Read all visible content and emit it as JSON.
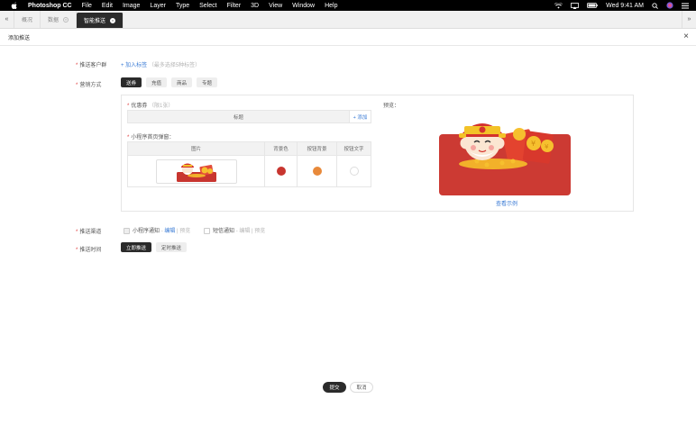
{
  "menubar": {
    "app_name": "Photoshop CC",
    "items": [
      "File",
      "Edit",
      "Image",
      "Layer",
      "Type",
      "Select",
      "Filter",
      "3D",
      "View",
      "Window",
      "Help"
    ],
    "clock": "Wed 9:41 AM"
  },
  "tabs": [
    {
      "label": "概况",
      "active": false,
      "closable": false
    },
    {
      "label": "数据",
      "active": false,
      "closable": true
    },
    {
      "label": "智能推送",
      "active": true,
      "closable": true
    }
  ],
  "header": {
    "title": "添加推送"
  },
  "form": {
    "audience": {
      "label": "推送客户群",
      "add_link": "+ 加入标签",
      "hint": "（最多选择5种标签）"
    },
    "marketing": {
      "label": "营销方式",
      "options": [
        "送券",
        "充值",
        "商品",
        "专题"
      ],
      "selected": 0
    },
    "coupon": {
      "label": "优惠券",
      "hint": "（限1张）",
      "title_col": "标题",
      "add_link": "+ 添加"
    },
    "popup": {
      "label": "小程序首页弹窗：",
      "columns": [
        "图片",
        "背景色",
        "按钮背景",
        "按钮文字"
      ],
      "colors": {
        "bg": "#c8352f",
        "button_bg": "#e8893a",
        "button_text": "#ffffff"
      }
    },
    "preview": {
      "label": "预览：",
      "example_link": "查看示例"
    },
    "channel": {
      "label": "推送渠道",
      "mini_program": {
        "label": "小程序通知",
        "edit": "编辑",
        "preview": "预览",
        "checked": true
      },
      "sms": {
        "label": "短信通知",
        "edit": "编辑",
        "preview": "预览",
        "checked": false
      }
    },
    "time": {
      "label": "推送时间",
      "options": [
        "立即推送",
        "定时推送"
      ],
      "selected": 0
    }
  },
  "actions": {
    "submit": "提交",
    "cancel": "取消"
  }
}
